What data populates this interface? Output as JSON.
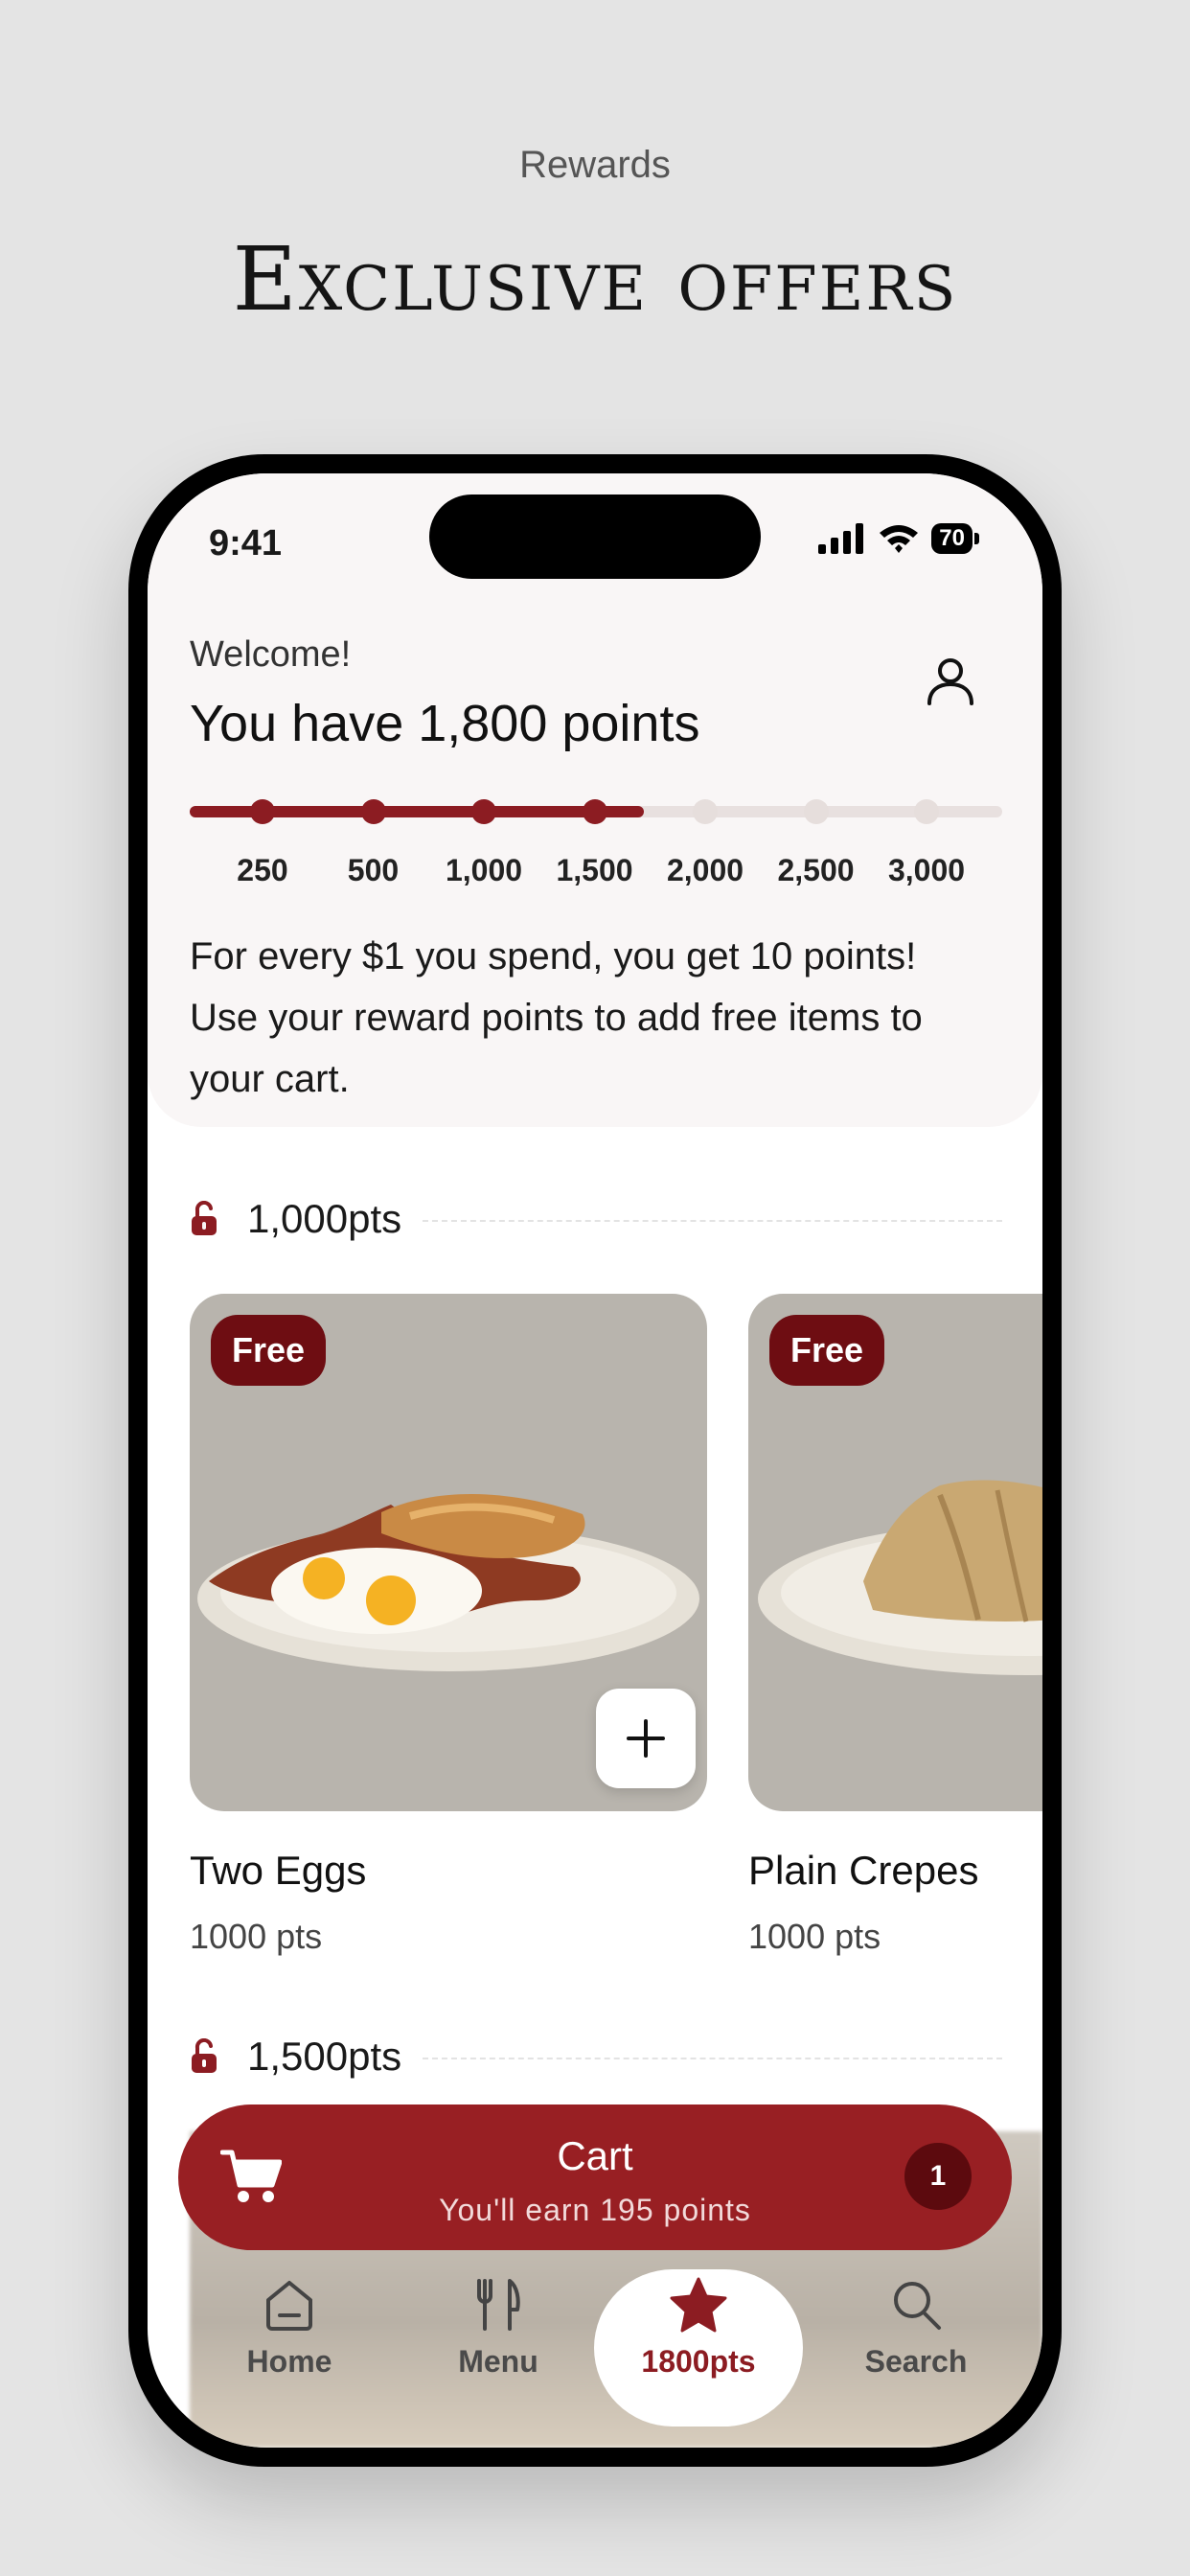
{
  "page": {
    "caption": "Rewards",
    "headline": "Exclusive offers"
  },
  "status_bar": {
    "time": "9:41",
    "battery": "70"
  },
  "header": {
    "welcome": "Welcome!",
    "points_title": "You have 1,800 points",
    "progress": {
      "current_points": 1800,
      "milestones": [
        "250",
        "500",
        "1,000",
        "1,500",
        "2,000",
        "2,500",
        "3,000"
      ],
      "reached_count": 4
    },
    "info": "For every $1 you spend, you get 10 points! Use your reward points to add free items to your cart."
  },
  "sections": [
    {
      "label": "1,000pts"
    },
    {
      "label": "1,500pts"
    }
  ],
  "cards": [
    {
      "badge": "Free",
      "name": "Two Eggs",
      "points": "1000 pts"
    },
    {
      "badge": "Free",
      "name": "Plain Crepes",
      "points": "1000 pts"
    }
  ],
  "cart": {
    "title": "Cart",
    "subtitle": "You'll earn 195 points",
    "count": "1"
  },
  "tabbar": {
    "items": [
      {
        "label": "Home",
        "icon": "home-icon"
      },
      {
        "label": "Menu",
        "icon": "utensils-icon"
      },
      {
        "label": "1800pts",
        "icon": "star-icon"
      },
      {
        "label": "Search",
        "icon": "search-icon"
      }
    ]
  },
  "colors": {
    "accent": "#8c1c22",
    "cart": "#981f23",
    "badge": "#6e0d12",
    "background": "#e4e4e4"
  }
}
